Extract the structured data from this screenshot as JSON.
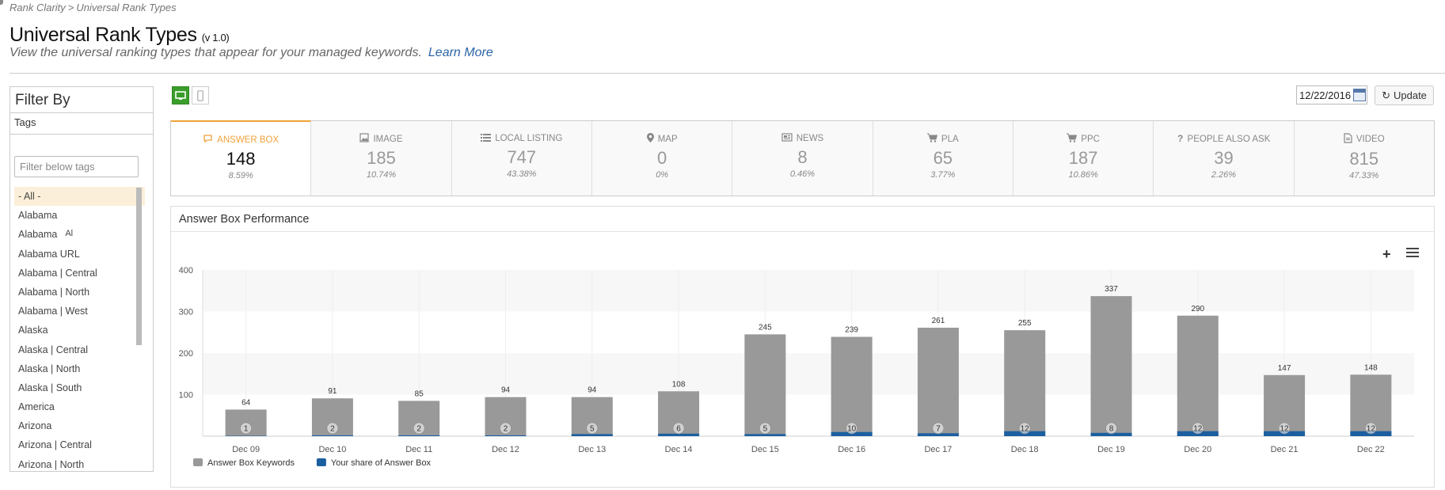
{
  "breadcrumb": {
    "root": "Rank Clarity",
    "sep": ">",
    "current": "Universal Rank Types"
  },
  "title": "Universal Rank Types",
  "version": "(v 1.0)",
  "subtitle": "View the universal ranking types that appear for your managed keywords.",
  "learn_more": "Learn More",
  "filter": {
    "heading": "Filter By",
    "tags_heading": "Tags",
    "placeholder": "Filter below tags",
    "items": [
      {
        "label": "- All -",
        "extra": ""
      },
      {
        "label": "Alabama",
        "extra": ""
      },
      {
        "label": "Alabama",
        "extra": "Al"
      },
      {
        "label": "Alabama URL",
        "extra": ""
      },
      {
        "label": "Alabama | Central",
        "extra": ""
      },
      {
        "label": "Alabama | North",
        "extra": ""
      },
      {
        "label": "Alabama | West",
        "extra": ""
      },
      {
        "label": "Alaska",
        "extra": ""
      },
      {
        "label": "Alaska | Central",
        "extra": ""
      },
      {
        "label": "Alaska | North",
        "extra": ""
      },
      {
        "label": "Alaska | South",
        "extra": ""
      },
      {
        "label": "America",
        "extra": ""
      },
      {
        "label": "Arizona",
        "extra": ""
      },
      {
        "label": "Arizona | Central",
        "extra": ""
      },
      {
        "label": "Arizona | North",
        "extra": ""
      }
    ]
  },
  "date": "12/22/2016",
  "update_label": "Update",
  "stats": [
    {
      "label": "Answer Box",
      "icon": "speech-bubble-icon",
      "value": "148",
      "pct": "8.59%"
    },
    {
      "label": "Image",
      "icon": "image-icon",
      "value": "185",
      "pct": "10.74%"
    },
    {
      "label": "Local Listing",
      "icon": "list-icon",
      "value": "747",
      "pct": "43.38%"
    },
    {
      "label": "Map",
      "icon": "map-pin-icon",
      "value": "0",
      "pct": "0%"
    },
    {
      "label": "News",
      "icon": "newspaper-icon",
      "value": "8",
      "pct": "0.46%"
    },
    {
      "label": "PLA",
      "icon": "cart-icon",
      "value": "65",
      "pct": "3.77%"
    },
    {
      "label": "PPC",
      "icon": "cart-icon",
      "value": "187",
      "pct": "10.86%"
    },
    {
      "label": "People Also Ask",
      "icon": "question-icon",
      "value": "39",
      "pct": "2.26%"
    },
    {
      "label": "Video",
      "icon": "document-icon",
      "value": "815",
      "pct": "47.33%"
    }
  ],
  "chart_title": "Answer Box Performance",
  "chart_data": {
    "type": "bar",
    "categories": [
      "Dec 09",
      "Dec 10",
      "Dec 11",
      "Dec 12",
      "Dec 13",
      "Dec 14",
      "Dec 15",
      "Dec 16",
      "Dec 17",
      "Dec 18",
      "Dec 19",
      "Dec 20",
      "Dec 21",
      "Dec 22"
    ],
    "series": [
      {
        "name": "Answer Box Keywords",
        "color": "#999999",
        "values": [
          64,
          91,
          85,
          94,
          94,
          108,
          245,
          239,
          261,
          255,
          337,
          290,
          147,
          148
        ]
      },
      {
        "name": "Your share of Answer Box",
        "color": "#1c5fa0",
        "values": [
          1,
          2,
          2,
          2,
          5,
          6,
          5,
          10,
          7,
          12,
          8,
          12,
          12,
          12
        ]
      }
    ],
    "yticks": [
      100,
      200,
      300,
      400
    ],
    "ylim": [
      0,
      400
    ],
    "grid": true,
    "legend": "bottom-left"
  }
}
